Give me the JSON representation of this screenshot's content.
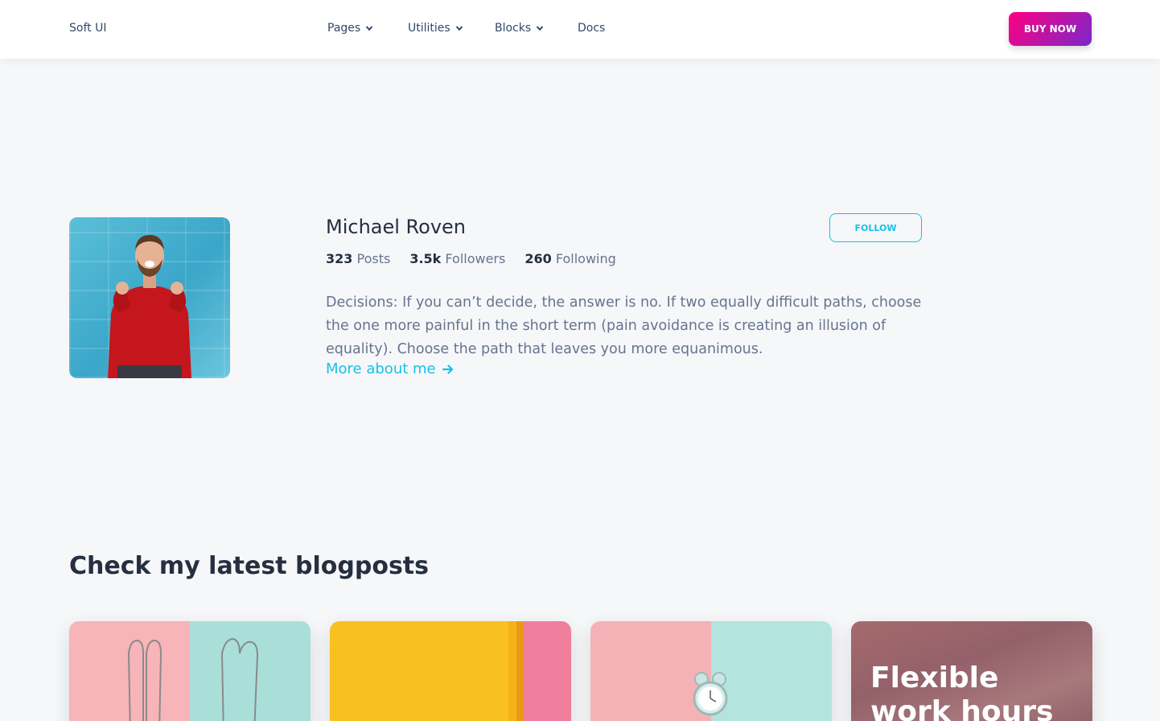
{
  "navbar": {
    "brand": "Soft UI",
    "items": [
      {
        "label": "Pages",
        "has_dropdown": true
      },
      {
        "label": "Utilities",
        "has_dropdown": true
      },
      {
        "label": "Blocks",
        "has_dropdown": true
      },
      {
        "label": "Docs",
        "has_dropdown": false
      }
    ],
    "buy_label": "BUY NOW"
  },
  "profile": {
    "name": "Michael Roven",
    "follow_label": "FOLLOW",
    "stats": [
      {
        "value": "323",
        "label": "Posts"
      },
      {
        "value": "3.5k",
        "label": "Followers"
      },
      {
        "value": "260",
        "label": "Following"
      }
    ],
    "bio": "Decisions: If you can’t decide, the answer is no. If two equally difficult paths, choose the one more painful in the short term (pain avoidance is creating an illusion of equality). Choose the path that leaves you more equanimous.",
    "more_label": "More about me"
  },
  "blog": {
    "title": "Check my latest blogposts",
    "cards": [
      {
        "icon": "necklace-image"
      },
      {
        "icon": "pencil-image"
      },
      {
        "icon": "alarm-clock-image"
      },
      {
        "text": "Flexible work hours"
      }
    ]
  },
  "colors": {
    "accent": "#17c1e8",
    "buy_gradient_start": "#ff0080",
    "buy_gradient_end": "#7928ca",
    "heading": "#252f40",
    "body_text": "#67748e"
  }
}
